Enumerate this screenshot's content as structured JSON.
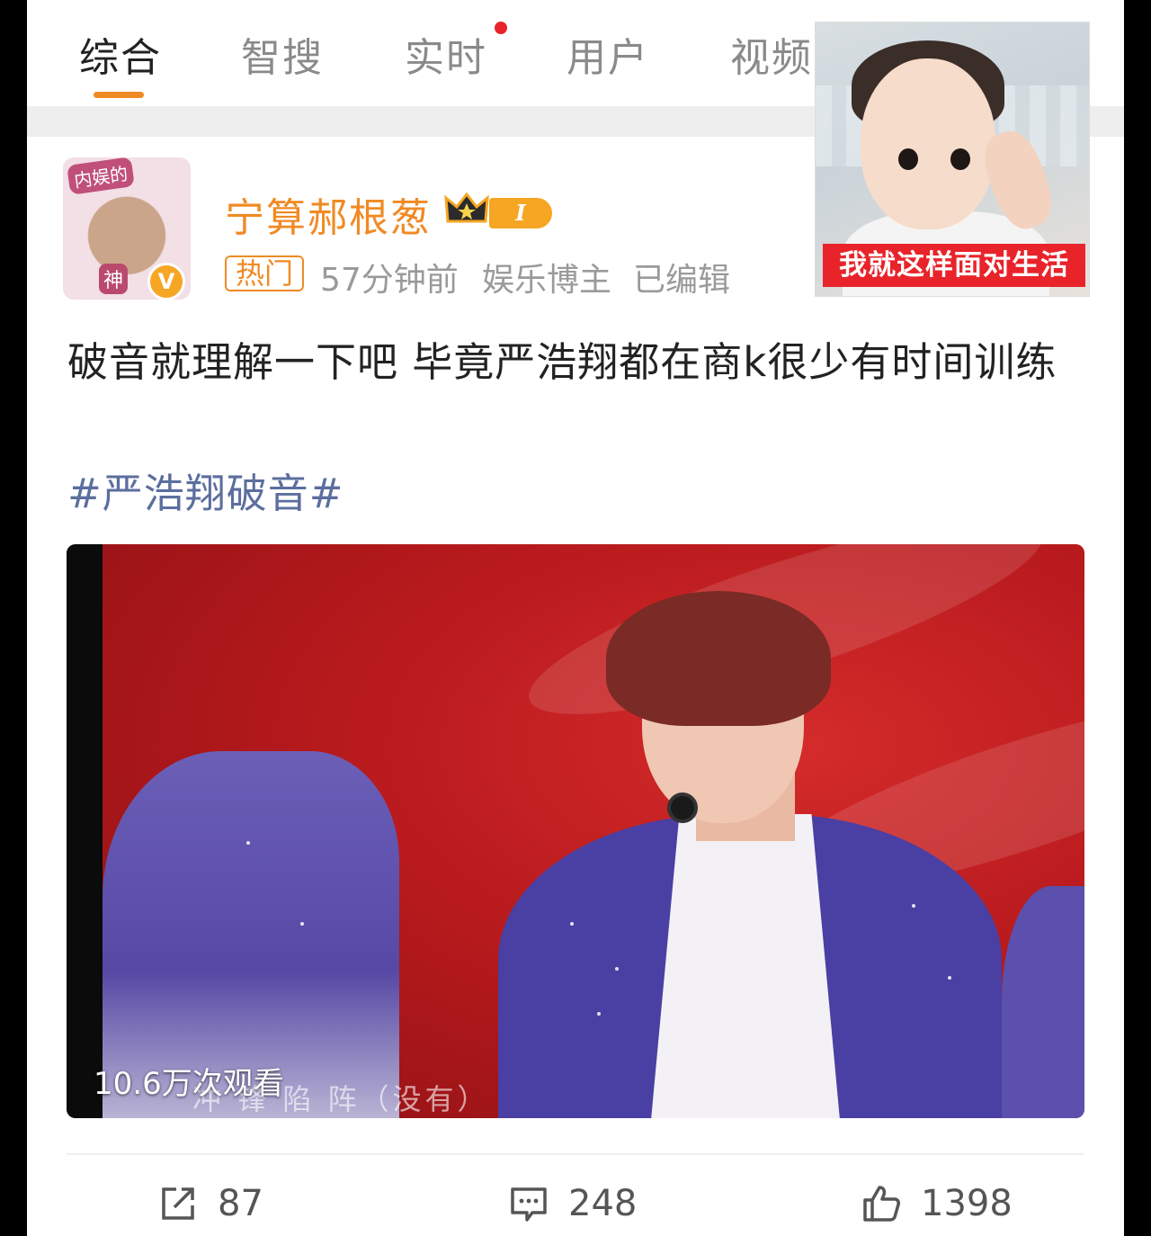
{
  "tabs": [
    {
      "label": "综合",
      "active": true
    },
    {
      "label": "智搜"
    },
    {
      "label": "实时",
      "badge_dot": true
    },
    {
      "label": "用户"
    },
    {
      "label": "视频"
    }
  ],
  "sticker": {
    "caption": "我就这样面对生活"
  },
  "post": {
    "avatar": {
      "tag_top": "内娱的",
      "tag_bottom": "神"
    },
    "username": "宁算郝根葱",
    "level": "I",
    "hot_label": "热门",
    "time": "57分钟前",
    "role": "娱乐博主",
    "edited": "已编辑",
    "text": "破音就理解一下吧 毕竟严浩翔都在商k很少有时间训练",
    "hashtag": "#严浩翔破音#",
    "video": {
      "views": "10.6万次观看",
      "subtitle": "冲 锋 陷 阵（没有）"
    }
  },
  "actions": {
    "repost_count": "87",
    "comment_count": "248",
    "like_count": "1398"
  },
  "colors": {
    "accent": "#f08a24",
    "hashtag": "#5b6e9e",
    "badge_red": "#e8242a"
  }
}
